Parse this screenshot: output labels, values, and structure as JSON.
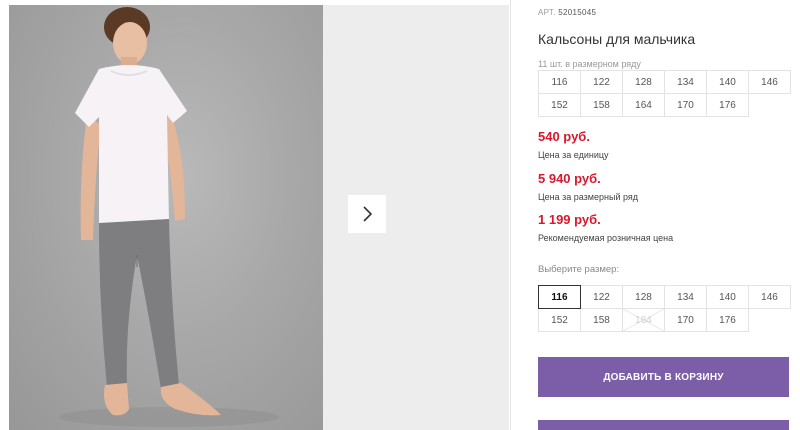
{
  "gallery": {
    "next_icon": "chevron-right-icon"
  },
  "product": {
    "sku_label": "АРТ.",
    "sku": "52015045",
    "title": "Кальсоны для мальчика",
    "row_hint": "11 шт. в размерном ряду",
    "row_sizes": [
      "116",
      "122",
      "128",
      "134",
      "140",
      "146",
      "152",
      "158",
      "164",
      "170",
      "176"
    ],
    "price_unit": "540 руб.",
    "price_unit_label": "Цена за единицу",
    "price_row": "5 940 руб.",
    "price_row_label": "Цена за размерный ряд",
    "price_retail": "1 199 руб.",
    "price_retail_label": "Рекомендуемая розничная цена",
    "choose_label": "Выберите размер:",
    "select_sizes": [
      "116",
      "122",
      "128",
      "134",
      "140",
      "146",
      "152",
      "158",
      "164",
      "170",
      "176"
    ],
    "selected_size": "116",
    "unavailable_size": "164",
    "add_to_cart": "ДОБАВИТЬ В КОРЗИНУ"
  },
  "colors": {
    "price_red": "#d9182d",
    "button_purple": "#7b5ea7"
  }
}
